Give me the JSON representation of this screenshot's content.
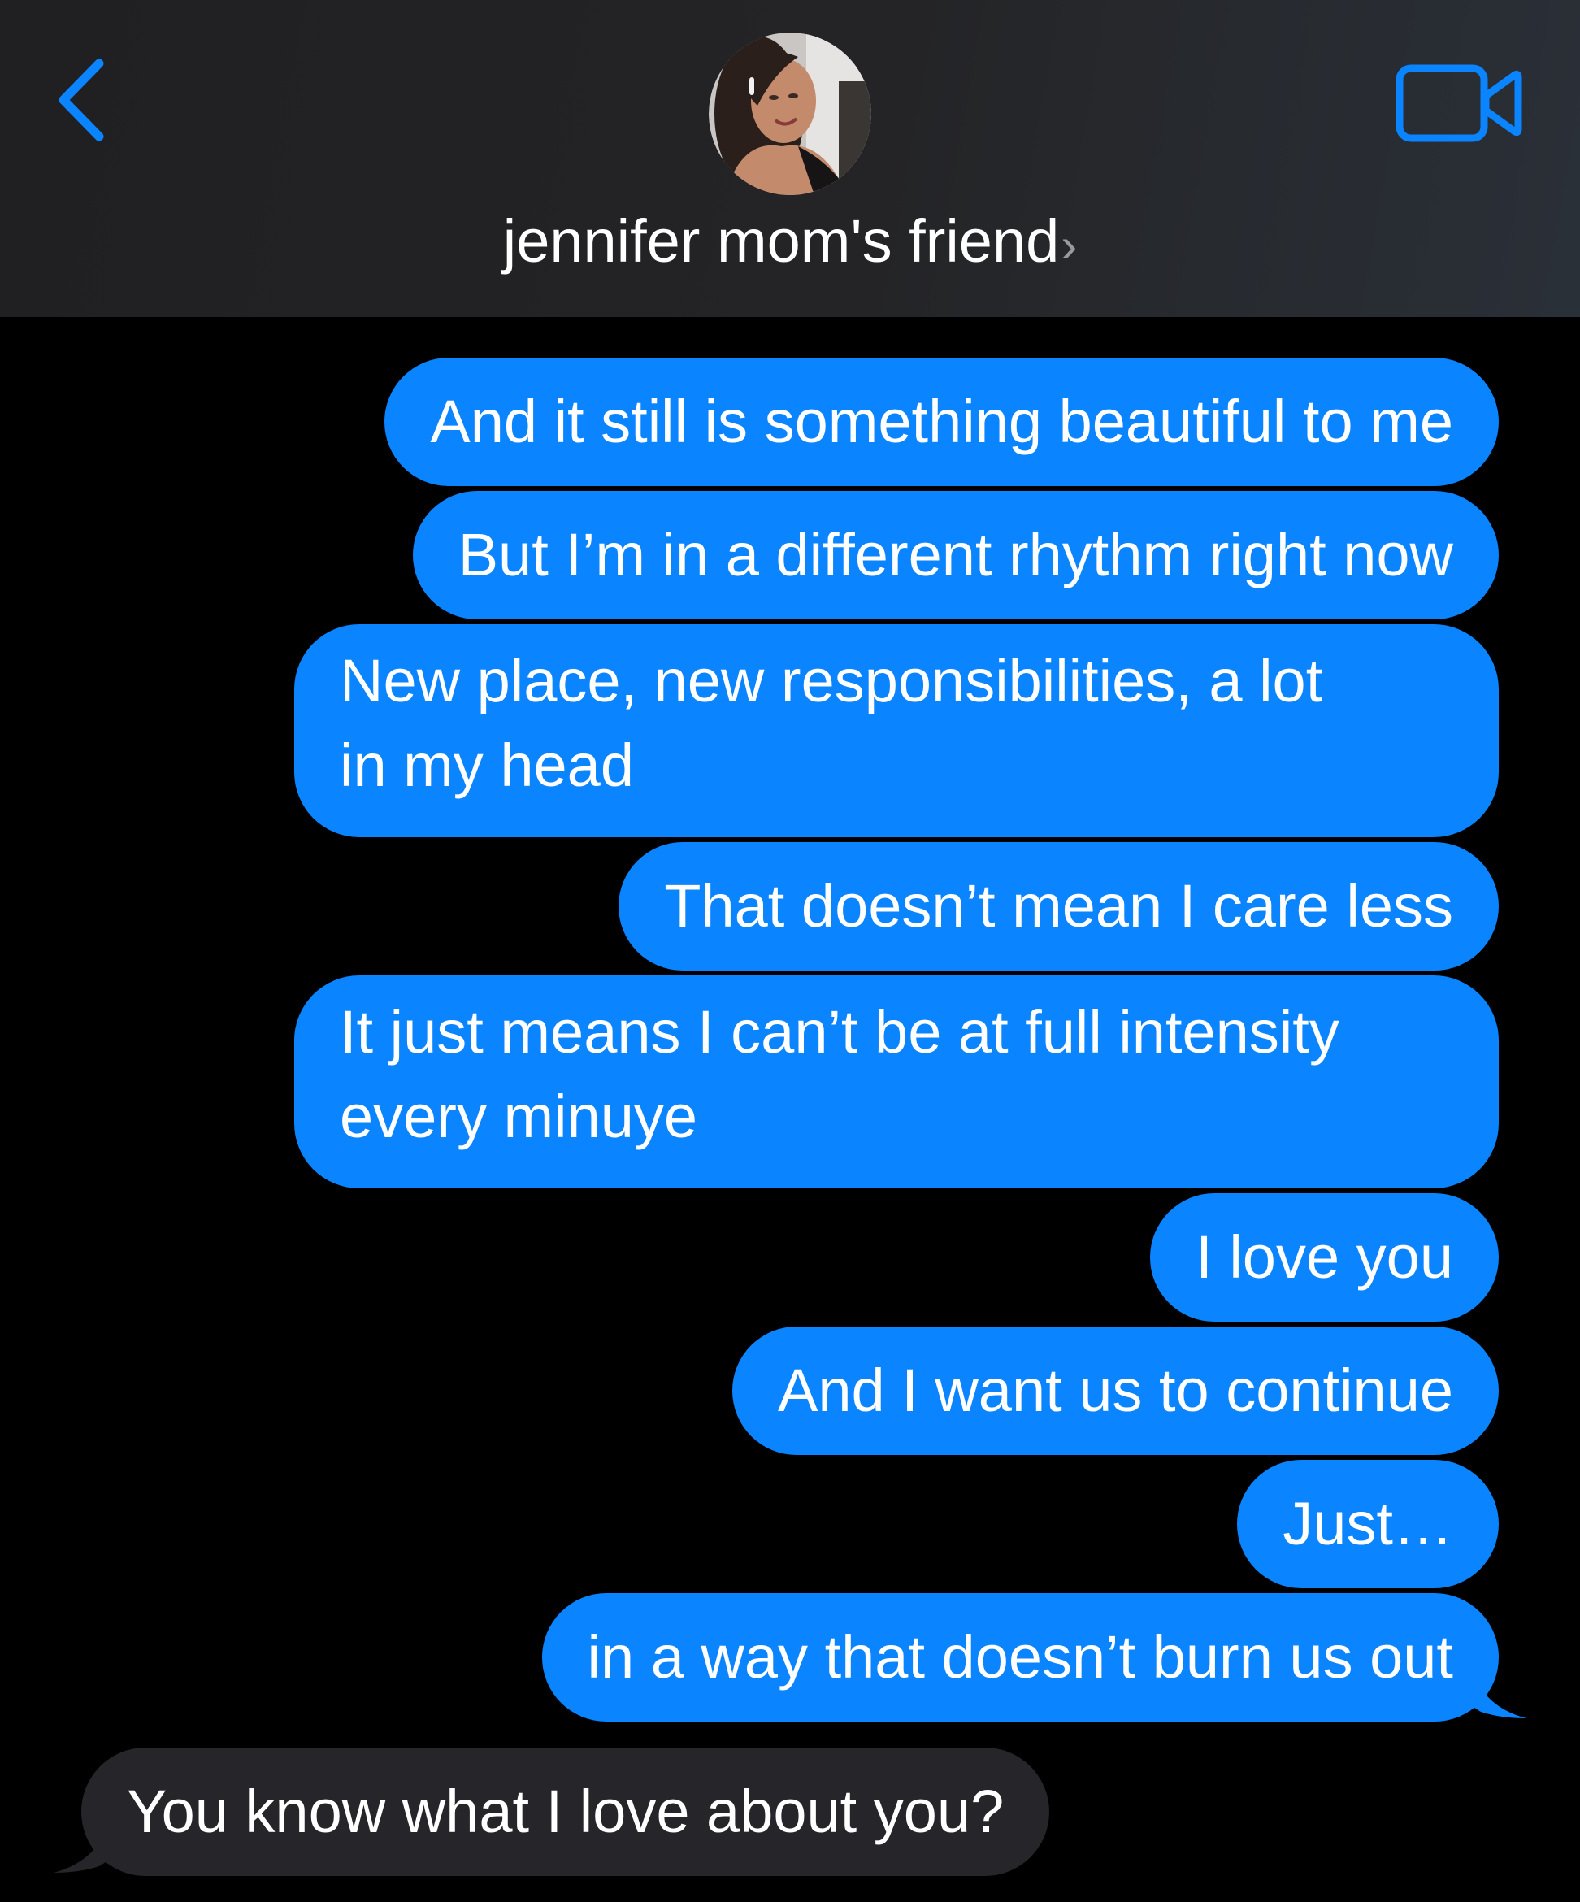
{
  "header": {
    "contact_name": "jennifer mom's friend",
    "chevron": "›",
    "back_icon": "chevron-left-icon",
    "video_icon": "video-camera-icon",
    "accent_color": "#0a84ff"
  },
  "messages": [
    {
      "direction": "outgoing",
      "text": "And it still is something beautiful to me"
    },
    {
      "direction": "outgoing",
      "text": "But I’m in a different rhythm right now"
    },
    {
      "direction": "outgoing",
      "lines": [
        "New place, new responsibilities, a lot",
        "in my head"
      ]
    },
    {
      "direction": "outgoing",
      "text": "That doesn’t mean I care less"
    },
    {
      "direction": "outgoing",
      "lines": [
        "It just means I can’t be at full intensity",
        "every minuye"
      ]
    },
    {
      "direction": "outgoing",
      "text": "I love you"
    },
    {
      "direction": "outgoing",
      "text": "And I want us to continue"
    },
    {
      "direction": "outgoing",
      "text": "Just…"
    },
    {
      "direction": "outgoing",
      "text": "in a way that doesn’t burn us out"
    },
    {
      "direction": "incoming",
      "text": "You know what I love about you?"
    }
  ],
  "colors": {
    "outgoing_bubble": "#0a84ff",
    "incoming_bubble": "#26252a",
    "background": "#000000"
  }
}
